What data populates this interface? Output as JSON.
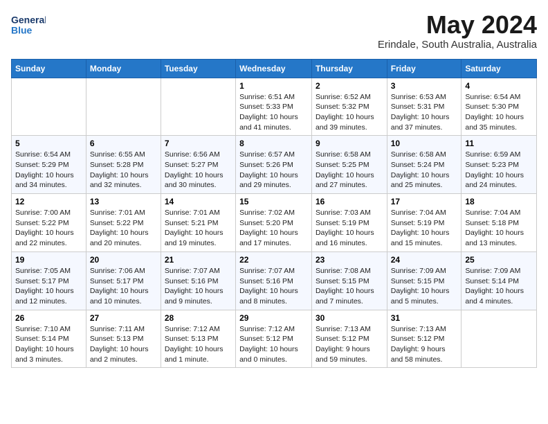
{
  "header": {
    "logo_line1": "General",
    "logo_line2": "Blue",
    "month": "May 2024",
    "location": "Erindale, South Australia, Australia"
  },
  "days_of_week": [
    "Sunday",
    "Monday",
    "Tuesday",
    "Wednesday",
    "Thursday",
    "Friday",
    "Saturday"
  ],
  "weeks": [
    [
      {
        "num": "",
        "sunrise": "",
        "sunset": "",
        "daylight": ""
      },
      {
        "num": "",
        "sunrise": "",
        "sunset": "",
        "daylight": ""
      },
      {
        "num": "",
        "sunrise": "",
        "sunset": "",
        "daylight": ""
      },
      {
        "num": "1",
        "sunrise": "Sunrise: 6:51 AM",
        "sunset": "Sunset: 5:33 PM",
        "daylight": "Daylight: 10 hours and 41 minutes."
      },
      {
        "num": "2",
        "sunrise": "Sunrise: 6:52 AM",
        "sunset": "Sunset: 5:32 PM",
        "daylight": "Daylight: 10 hours and 39 minutes."
      },
      {
        "num": "3",
        "sunrise": "Sunrise: 6:53 AM",
        "sunset": "Sunset: 5:31 PM",
        "daylight": "Daylight: 10 hours and 37 minutes."
      },
      {
        "num": "4",
        "sunrise": "Sunrise: 6:54 AM",
        "sunset": "Sunset: 5:30 PM",
        "daylight": "Daylight: 10 hours and 35 minutes."
      }
    ],
    [
      {
        "num": "5",
        "sunrise": "Sunrise: 6:54 AM",
        "sunset": "Sunset: 5:29 PM",
        "daylight": "Daylight: 10 hours and 34 minutes."
      },
      {
        "num": "6",
        "sunrise": "Sunrise: 6:55 AM",
        "sunset": "Sunset: 5:28 PM",
        "daylight": "Daylight: 10 hours and 32 minutes."
      },
      {
        "num": "7",
        "sunrise": "Sunrise: 6:56 AM",
        "sunset": "Sunset: 5:27 PM",
        "daylight": "Daylight: 10 hours and 30 minutes."
      },
      {
        "num": "8",
        "sunrise": "Sunrise: 6:57 AM",
        "sunset": "Sunset: 5:26 PM",
        "daylight": "Daylight: 10 hours and 29 minutes."
      },
      {
        "num": "9",
        "sunrise": "Sunrise: 6:58 AM",
        "sunset": "Sunset: 5:25 PM",
        "daylight": "Daylight: 10 hours and 27 minutes."
      },
      {
        "num": "10",
        "sunrise": "Sunrise: 6:58 AM",
        "sunset": "Sunset: 5:24 PM",
        "daylight": "Daylight: 10 hours and 25 minutes."
      },
      {
        "num": "11",
        "sunrise": "Sunrise: 6:59 AM",
        "sunset": "Sunset: 5:23 PM",
        "daylight": "Daylight: 10 hours and 24 minutes."
      }
    ],
    [
      {
        "num": "12",
        "sunrise": "Sunrise: 7:00 AM",
        "sunset": "Sunset: 5:22 PM",
        "daylight": "Daylight: 10 hours and 22 minutes."
      },
      {
        "num": "13",
        "sunrise": "Sunrise: 7:01 AM",
        "sunset": "Sunset: 5:22 PM",
        "daylight": "Daylight: 10 hours and 20 minutes."
      },
      {
        "num": "14",
        "sunrise": "Sunrise: 7:01 AM",
        "sunset": "Sunset: 5:21 PM",
        "daylight": "Daylight: 10 hours and 19 minutes."
      },
      {
        "num": "15",
        "sunrise": "Sunrise: 7:02 AM",
        "sunset": "Sunset: 5:20 PM",
        "daylight": "Daylight: 10 hours and 17 minutes."
      },
      {
        "num": "16",
        "sunrise": "Sunrise: 7:03 AM",
        "sunset": "Sunset: 5:19 PM",
        "daylight": "Daylight: 10 hours and 16 minutes."
      },
      {
        "num": "17",
        "sunrise": "Sunrise: 7:04 AM",
        "sunset": "Sunset: 5:19 PM",
        "daylight": "Daylight: 10 hours and 15 minutes."
      },
      {
        "num": "18",
        "sunrise": "Sunrise: 7:04 AM",
        "sunset": "Sunset: 5:18 PM",
        "daylight": "Daylight: 10 hours and 13 minutes."
      }
    ],
    [
      {
        "num": "19",
        "sunrise": "Sunrise: 7:05 AM",
        "sunset": "Sunset: 5:17 PM",
        "daylight": "Daylight: 10 hours and 12 minutes."
      },
      {
        "num": "20",
        "sunrise": "Sunrise: 7:06 AM",
        "sunset": "Sunset: 5:17 PM",
        "daylight": "Daylight: 10 hours and 10 minutes."
      },
      {
        "num": "21",
        "sunrise": "Sunrise: 7:07 AM",
        "sunset": "Sunset: 5:16 PM",
        "daylight": "Daylight: 10 hours and 9 minutes."
      },
      {
        "num": "22",
        "sunrise": "Sunrise: 7:07 AM",
        "sunset": "Sunset: 5:16 PM",
        "daylight": "Daylight: 10 hours and 8 minutes."
      },
      {
        "num": "23",
        "sunrise": "Sunrise: 7:08 AM",
        "sunset": "Sunset: 5:15 PM",
        "daylight": "Daylight: 10 hours and 7 minutes."
      },
      {
        "num": "24",
        "sunrise": "Sunrise: 7:09 AM",
        "sunset": "Sunset: 5:15 PM",
        "daylight": "Daylight: 10 hours and 5 minutes."
      },
      {
        "num": "25",
        "sunrise": "Sunrise: 7:09 AM",
        "sunset": "Sunset: 5:14 PM",
        "daylight": "Daylight: 10 hours and 4 minutes."
      }
    ],
    [
      {
        "num": "26",
        "sunrise": "Sunrise: 7:10 AM",
        "sunset": "Sunset: 5:14 PM",
        "daylight": "Daylight: 10 hours and 3 minutes."
      },
      {
        "num": "27",
        "sunrise": "Sunrise: 7:11 AM",
        "sunset": "Sunset: 5:13 PM",
        "daylight": "Daylight: 10 hours and 2 minutes."
      },
      {
        "num": "28",
        "sunrise": "Sunrise: 7:12 AM",
        "sunset": "Sunset: 5:13 PM",
        "daylight": "Daylight: 10 hours and 1 minute."
      },
      {
        "num": "29",
        "sunrise": "Sunrise: 7:12 AM",
        "sunset": "Sunset: 5:12 PM",
        "daylight": "Daylight: 10 hours and 0 minutes."
      },
      {
        "num": "30",
        "sunrise": "Sunrise: 7:13 AM",
        "sunset": "Sunset: 5:12 PM",
        "daylight": "Daylight: 9 hours and 59 minutes."
      },
      {
        "num": "31",
        "sunrise": "Sunrise: 7:13 AM",
        "sunset": "Sunset: 5:12 PM",
        "daylight": "Daylight: 9 hours and 58 minutes."
      },
      {
        "num": "",
        "sunrise": "",
        "sunset": "",
        "daylight": ""
      }
    ]
  ]
}
